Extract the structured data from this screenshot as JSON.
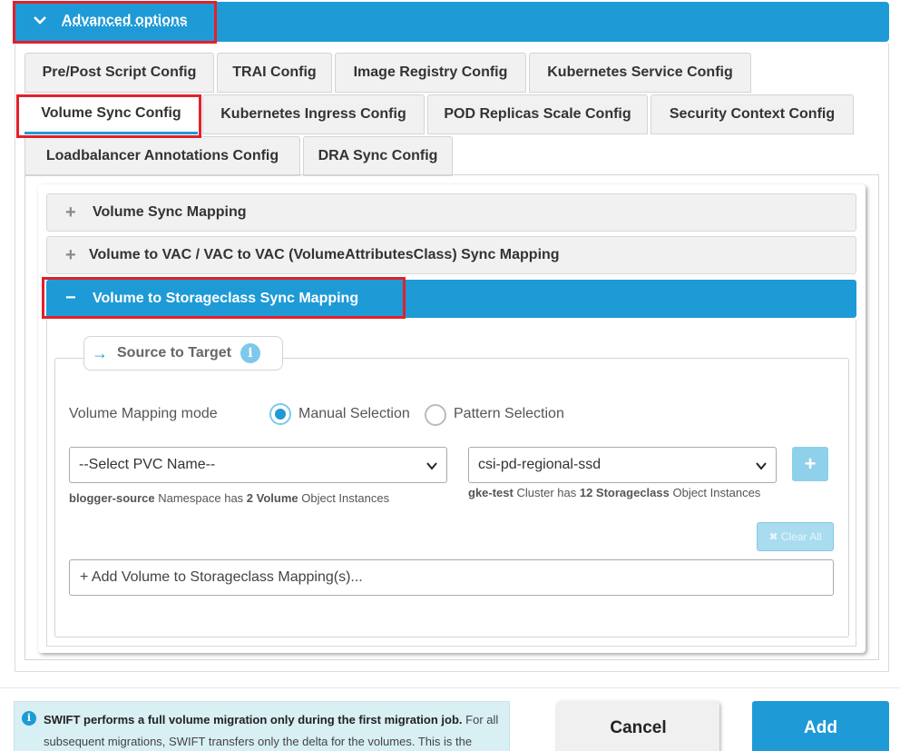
{
  "advanced": {
    "title": "Advanced options"
  },
  "tabs": [
    "Pre/Post Script Config",
    "TRAI Config",
    "Image Registry Config",
    "Kubernetes Service Config",
    "Volume Sync Config",
    "Kubernetes Ingress Config",
    "POD Replicas Scale Config",
    "Security Context Config",
    "Loadbalancer Annotations Config",
    "DRA Sync Config"
  ],
  "accordion": {
    "volume_sync_mapping": "Volume Sync Mapping",
    "vac_mapping": "Volume to VAC / VAC to VAC (VolumeAttributesClass) Sync Mapping",
    "storageclass_mapping": "Volume to Storageclass Sync Mapping"
  },
  "form": {
    "legend": "Source to Target",
    "mode_label": "Volume Mapping mode",
    "radio_manual": "Manual Selection",
    "radio_pattern": "Pattern Selection",
    "pvc_select": "--Select PVC Name--",
    "storageclass_select": "csi-pd-regional-ssd",
    "source_hint": {
      "namespace": "blogger-source",
      "text1": " Namespace has ",
      "count": "2 Volume",
      "text2": " Object Instances"
    },
    "target_hint": {
      "cluster": "gke-test",
      "text1": " Cluster has ",
      "count": "12 Storageclass",
      "text2": " Object Instances"
    },
    "clear_all": "✖ Clear All",
    "add_mapping": "+ Add Volume to Storageclass Mapping(s)..."
  },
  "footer": {
    "notice_bold": "SWIFT performs a full volume migration only during the first migration job.",
    "notice_rest": " For all subsequent migrations, SWIFT transfers only the delta for the volumes. This is the",
    "cancel": "Cancel",
    "add": "Add"
  }
}
